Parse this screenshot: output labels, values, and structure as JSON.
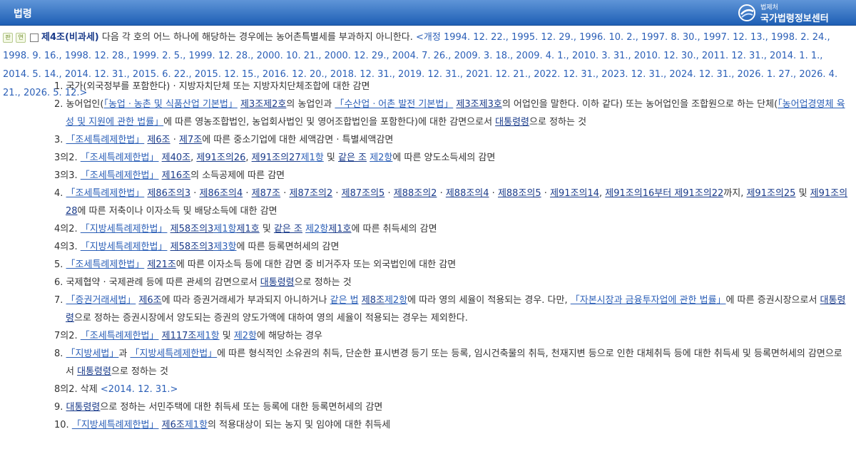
{
  "header": {
    "title": "법령",
    "logo_small": "법제처",
    "logo_big": "국가법령정보센터"
  },
  "article": {
    "badge1": "판",
    "badge2": "연",
    "number": "제4조(비과세)",
    "text": " 다음 각 호의 어느 하나에 해당하는 경우에는 농어촌특별세를 부과하지 아니한다.",
    "revision": "<개정 1994. 12. 22., 1995. 12. 29., 1996. 10. 2., 1997. 8. 30., 1997. 12. 13., 1998. 2. 24., 1998. 9. 16., 1998. 12. 28., 1999. 2. 5., 1999. 12. 28., 2000. 10. 21., 2000. 12. 29., 2004. 7. 26., 2009. 3. 18., 2009. 4. 1., 2010. 3. 31., 2010. 12. 30., 2011. 12. 31., 2014. 1. 1., 2014. 5. 14., 2014. 12. 31., 2015. 6. 22., 2015. 12. 15., 2016. 12. 20., 2018. 12. 31., 2019. 12. 31., 2021. 12. 21., 2022. 12. 31., 2023. 12. 31., 2024. 12. 31., 2026. 1. 27., 2026. 4. 21., 2026. 5. 12.>"
  },
  "items": {
    "i1": {
      "t1": "1. 국가(외국정부를 포함한다) · 지방자치단체 또는 지방자치단체조합에 대한 감면"
    },
    "i2": {
      "t1": "2. 농어업인(",
      "l1": "「농업ㆍ농촌 및 식품산업 기본법」",
      "t2": " ",
      "l2": "제3조제2호",
      "t3": "의 농업인과 ",
      "l3": "「수산업ㆍ어촌 발전 기본법」",
      "t4": " ",
      "l4": "제3조제3호",
      "t5": "의 어업인을 말한다. 이하 같다) 또는 농어업인을 조합원으로 하는 단체(",
      "l5": "「농어업경영체 육성 및 지원에 관한 법률」",
      "t6": "에 따른 영농조합법인, 농업회사법인 및 영어조합법인을 포함한다)에 대한 감면으로서 ",
      "l6": "대통령령",
      "t7": "으로 정하는 것"
    },
    "i3": {
      "t1": "3. ",
      "l1": "「조세특례제한법」",
      "t2": " ",
      "l2": "제6조",
      "t3": " · ",
      "l3": "제7조",
      "t4": "에 따른 중소기업에 대한 세액감면 · 특별세액감면"
    },
    "i3_2": {
      "t1": "3의2. ",
      "l1": "「조세특례제한법」",
      "t2": " ",
      "l2": "제40조",
      "t3": ", ",
      "l3": "제91조의26",
      "t4": ", ",
      "l4": "제91조의27",
      "l5": "제1항",
      "t5": " 및 ",
      "l6": "같은 조",
      "t6": " ",
      "l7": "제2항",
      "t7": "에 따른 양도소득세의 감면"
    },
    "i3_3": {
      "t1": "3의3. ",
      "l1": "「조세특례제한법」",
      "t2": " ",
      "l2": "제16조",
      "t3": "의 소득공제에 따른 감면"
    },
    "i4": {
      "t1": "4. ",
      "l1": "「조세특례제한법」",
      "t2": " ",
      "l2": "제86조의3",
      "t3": " · ",
      "l3": "제86조의4",
      "t4": " · ",
      "l4": "제87조",
      "t5": " · ",
      "l5": "제87조의2",
      "t6": " · ",
      "l6": "제87조의5",
      "t7": " · ",
      "l7": "제88조의2",
      "t8": " · ",
      "l8": "제88조의4",
      "t9": " · ",
      "l9": "제88조의5",
      "t10": " · ",
      "l10": "제91조의14",
      "t11": ", ",
      "l11": "제91조의16부터 제91조의22",
      "t12": "까지, ",
      "l12": "제91조의25",
      "t13": " 및 ",
      "l13": "제91조의28",
      "t14": "에 따른 저축이나 이자소득 및 배당소득에 대한 감면"
    },
    "i4_2": {
      "t1": "4의2. ",
      "l1": "「지방세특례제한법」",
      "t2": " ",
      "l2": "제58조의3",
      "l3": "제1항",
      "l4": "제1호",
      "t3": " 및 ",
      "l5": "같은 조",
      "t4": " ",
      "l6": "제2항",
      "l7": "제1호",
      "t5": "에 따른 취득세의 감면"
    },
    "i4_3": {
      "t1": "4의3. ",
      "l1": "「지방세특례제한법」",
      "t2": " ",
      "l2": "제58조의3",
      "l3": "제3항",
      "t3": "에 따른 등록면허세의 감면"
    },
    "i5": {
      "t1": "5. ",
      "l1": "「조세특례제한법」",
      "t2": " ",
      "l2": "제21조",
      "t3": "에 따른 이자소득 등에 대한 감면 중 비거주자 또는 외국법인에 대한 감면"
    },
    "i6": {
      "t1": "6. 국제협약 · 국제관례 등에 따른 관세의 감면으로서 ",
      "l1": "대통령령",
      "t2": "으로 정하는 것"
    },
    "i7": {
      "t1": "7. ",
      "l1": "「증권거래세법」",
      "t2": " ",
      "l2": "제6조",
      "t3": "에 따라 증권거래세가 부과되지 아니하거나 ",
      "l3": "같은 법",
      "t4": " ",
      "l4": "제8조",
      "l5": "제2항",
      "t5": "에 따라 영의 세율이 적용되는 경우. 다만, ",
      "l6": "「자본시장과 금융투자업에 관한 법률」",
      "t6": "에 따른 증권시장으로서 ",
      "l7": "대통령령",
      "t7": "으로 정하는 증권시장에서 양도되는 증권의 양도가액에 대하여 영의 세율이 적용되는 경우는 제외한다."
    },
    "i7_2": {
      "t1": "7의2. ",
      "l1": "「조세특례제한법」",
      "t2": " ",
      "l2": "제117조",
      "l3": "제1항",
      "t3": " 및 ",
      "l4": "제2항",
      "t4": "에 해당하는 경우"
    },
    "i8": {
      "t1": "8. ",
      "l1": "「지방세법」",
      "t2": "과 ",
      "l2": "「지방세특례제한법」",
      "t3": "에 따른 형식적인 소유권의 취득, 단순한 표시변경 등기 또는 등록, 임시건축물의 취득, 천재지변 등으로 인한 대체취득 등에 대한 취득세 및 등록면허세의 감면으로서 ",
      "l3": "대통령령",
      "t4": "으로 정하는 것"
    },
    "i8_2": {
      "t1": "8의2. 삭제 ",
      "d1": "<2014. 12. 31.>"
    },
    "i9": {
      "t1": "9. ",
      "l1": "대통령령",
      "t2": "으로 정하는 서민주택에 대한 취득세 또는 등록에 대한 등록면허세의 감면"
    },
    "i10": {
      "t1": "10. ",
      "l1": "「지방세특례제한법」",
      "t2": " ",
      "l2": "제6조",
      "l3": "제1항",
      "t3": "의 적용대상이 되는 농지 및 임야에 대한 취득세"
    }
  }
}
